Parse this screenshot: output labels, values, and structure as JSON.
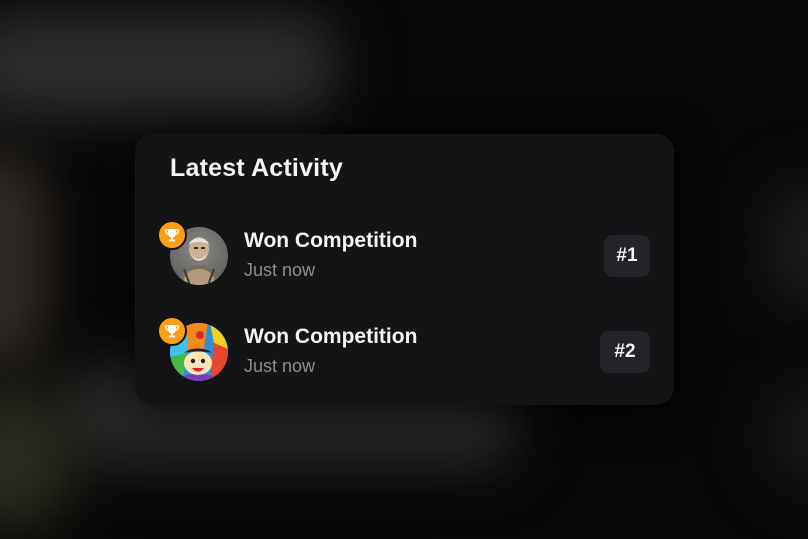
{
  "card": {
    "title": "Latest Activity"
  },
  "activities": [
    {
      "title": "Won Competition",
      "time": "Just now",
      "rank": "#1",
      "badge_icon": "trophy-icon",
      "avatar": "old-man-avatar"
    },
    {
      "title": "Won Competition",
      "time": "Just now",
      "rank": "#2",
      "badge_icon": "trophy-icon",
      "avatar": "cartoon-wizard-avatar"
    }
  ],
  "colors": {
    "card_bg": "#131416",
    "badge": "#ff9e0f",
    "rank_bg": "#232427",
    "muted_text": "#8b8d90"
  }
}
